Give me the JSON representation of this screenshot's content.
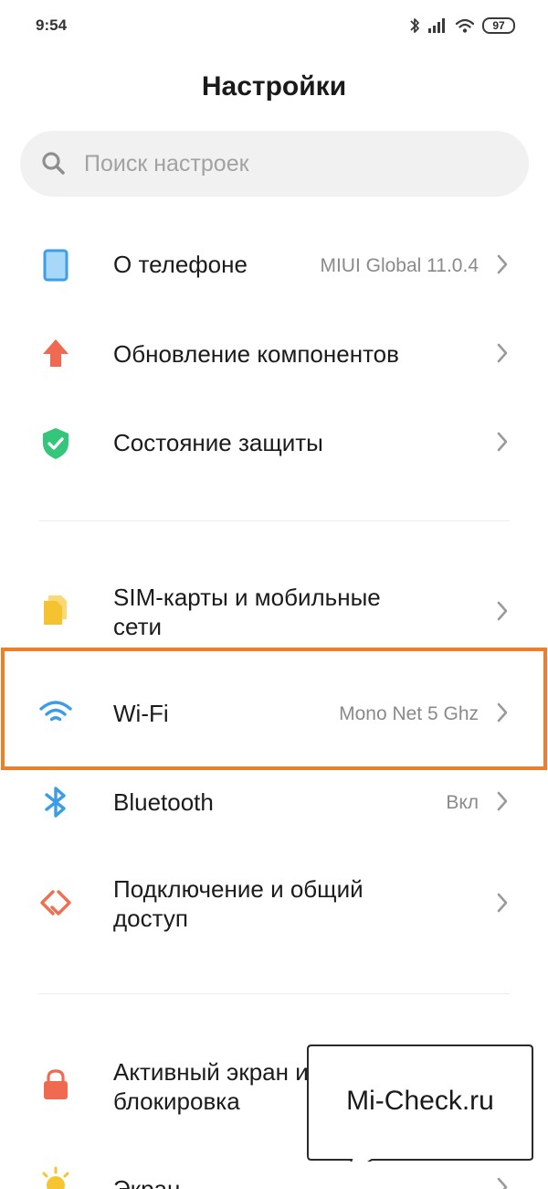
{
  "status_bar": {
    "time": "9:54",
    "battery": "97",
    "icons": [
      "bluetooth-icon",
      "signal-icon",
      "wifi-icon",
      "battery-icon"
    ]
  },
  "title": "Настройки",
  "search": {
    "placeholder": "Поиск настроек"
  },
  "items": [
    {
      "label": "О телефоне",
      "value": "MIUI Global 11.0.4",
      "icon": "phone-icon",
      "color": "#4aa8e8"
    },
    {
      "label": "Обновление компонентов",
      "icon": "update-arrow-icon",
      "color": "#f06a52"
    },
    {
      "label": "Состояние защиты",
      "icon": "shield-check-icon",
      "color": "#34c77b"
    },
    {
      "label_lines": [
        "SIM-карты и мобильные",
        "сети"
      ],
      "icon": "sim-cards-icon",
      "color": "#f5c842"
    },
    {
      "label": "Wi-Fi",
      "value": "Mono Net 5 Ghz",
      "icon": "wifi-icon",
      "color": "#3b9de6"
    },
    {
      "label": "Bluetooth",
      "value": "Вкл",
      "icon": "bluetooth-icon",
      "color": "#3b9de6"
    },
    {
      "label_lines": [
        "Подключение и общий",
        "доступ"
      ],
      "icon": "share-connection-icon",
      "color": "#ef6f52"
    },
    {
      "label_lines": [
        "Активный экран и",
        "блокировка"
      ],
      "icon": "lock-icon",
      "color": "#f06a52"
    },
    {
      "label": "Экран",
      "icon": "sun-icon",
      "color": "#f7c531"
    }
  ],
  "highlight_color": "#f07d2a",
  "watermark": {
    "text": "Mi-Check.ru"
  }
}
